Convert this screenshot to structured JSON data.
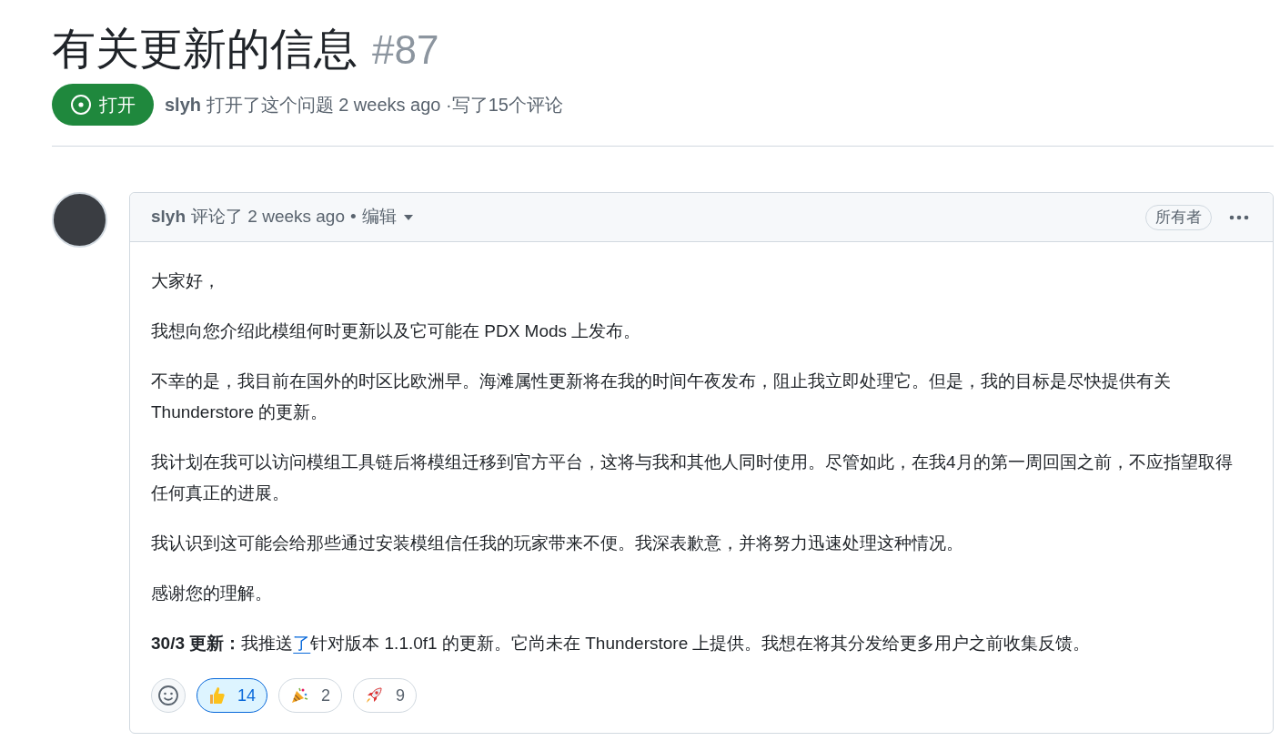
{
  "issue": {
    "title": "有关更新的信息",
    "number": "#87",
    "state": {
      "label": "打开",
      "kind": "open"
    },
    "author": "slyh",
    "meta": "打开了这个问题 2 weeks ago ·写了15个评论"
  },
  "comment": {
    "author": "slyh",
    "action": "评论了 2 weeks ago",
    "separator": "•",
    "edited": "编辑",
    "role": "所有者",
    "paragraphs": [
      {
        "parts": [
          {
            "kind": "text",
            "text": "大家好，"
          }
        ]
      },
      {
        "parts": [
          {
            "kind": "text",
            "text": "我想向您介绍此模组何时更新以及它可能在 PDX Mods 上发布。"
          }
        ]
      },
      {
        "parts": [
          {
            "kind": "text",
            "text": "不幸的是，我目前在国外的时区比欧洲早。海滩属性更新将在我的时间午夜发布，阻止我立即处理它。但是，我的目标是尽快提供有关 Thunderstore 的更新。"
          }
        ]
      },
      {
        "parts": [
          {
            "kind": "text",
            "text": "我计划在我可以访问模组工具链后将模组迁移到官方平台，这将与我和其他人同时使用。尽管如此，在我4月的第一周回国之前，不应指望取得任何真正的进展。"
          }
        ]
      },
      {
        "parts": [
          {
            "kind": "text",
            "text": "我认识到这可能会给那些通过安装模组信任我的玩家带来不便。我深表歉意，并将努力迅速处理这种情况。"
          }
        ]
      },
      {
        "parts": [
          {
            "kind": "text",
            "text": "感谢您的理解。"
          }
        ]
      },
      {
        "parts": [
          {
            "kind": "text",
            "text": "**30/3 更新：**我推送"
          },
          {
            "kind": "link",
            "text": "了"
          },
          {
            "kind": "text",
            "text": "针对版本 1.1.0f1 的更新。它尚未在 Thunderstore 上提供。我想在将其分发给更多用户之前收集反馈。"
          }
        ]
      }
    ],
    "reactions": [
      {
        "kind": "thumbs-up",
        "count": "14",
        "selected": true
      },
      {
        "kind": "party",
        "count": "2",
        "selected": false
      },
      {
        "kind": "rocket",
        "count": "9",
        "selected": false
      }
    ]
  }
}
